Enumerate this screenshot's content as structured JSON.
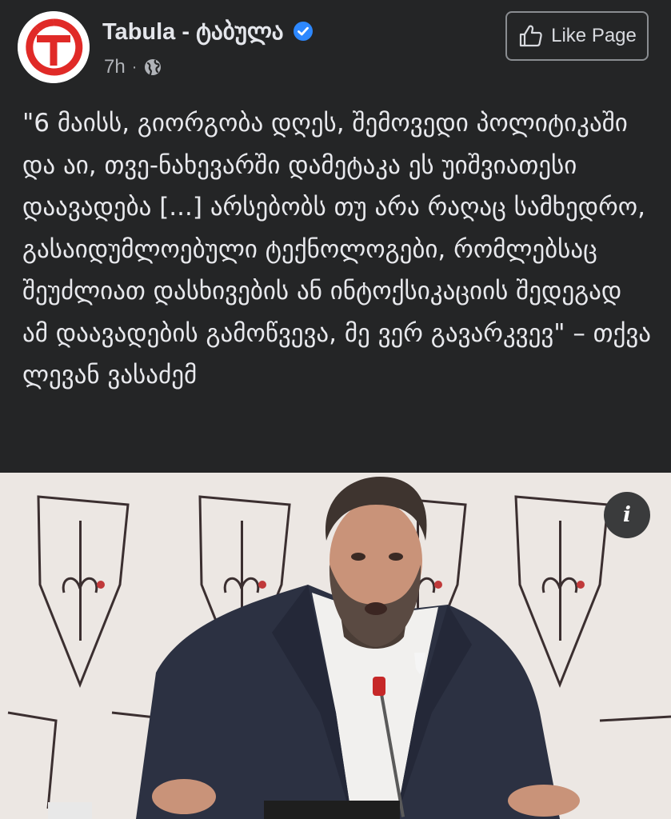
{
  "header": {
    "page_name": "Tabula - ტაბულა",
    "timestamp": "7h",
    "separator": "·",
    "audience_icon": "globe-icon",
    "verified_icon": "verified-badge-icon",
    "like_button_label": "Like Page",
    "like_icon": "thumbs-up-icon"
  },
  "post": {
    "text": "\"6 მაისს, გიორგობა დღეს, შემოვედი პოლიტიკაში და აი, თვე-ნახევარში დამეტაკა ეს უიშვიათესი დაავადება [...] არსებობს თუ არა რაღაც სამხედრო, გასაიდუმლოებული ტექნოლოგები, რომლებსაც შეუძლიათ დასხივების ან ინტოქსიკაციის შედეგად ამ დაავადების გამოწვევა, მე ვერ გავარკვევ\" – თქვა ლევან ვასაძემ"
  },
  "photo": {
    "info_icon": "info-icon",
    "info_label": "i"
  },
  "colors": {
    "background": "#242526",
    "text": "#e4e6eb",
    "secondary_text": "#b0b3b8",
    "verified_blue": "#2d88ff",
    "logo_red": "#e02a27"
  }
}
